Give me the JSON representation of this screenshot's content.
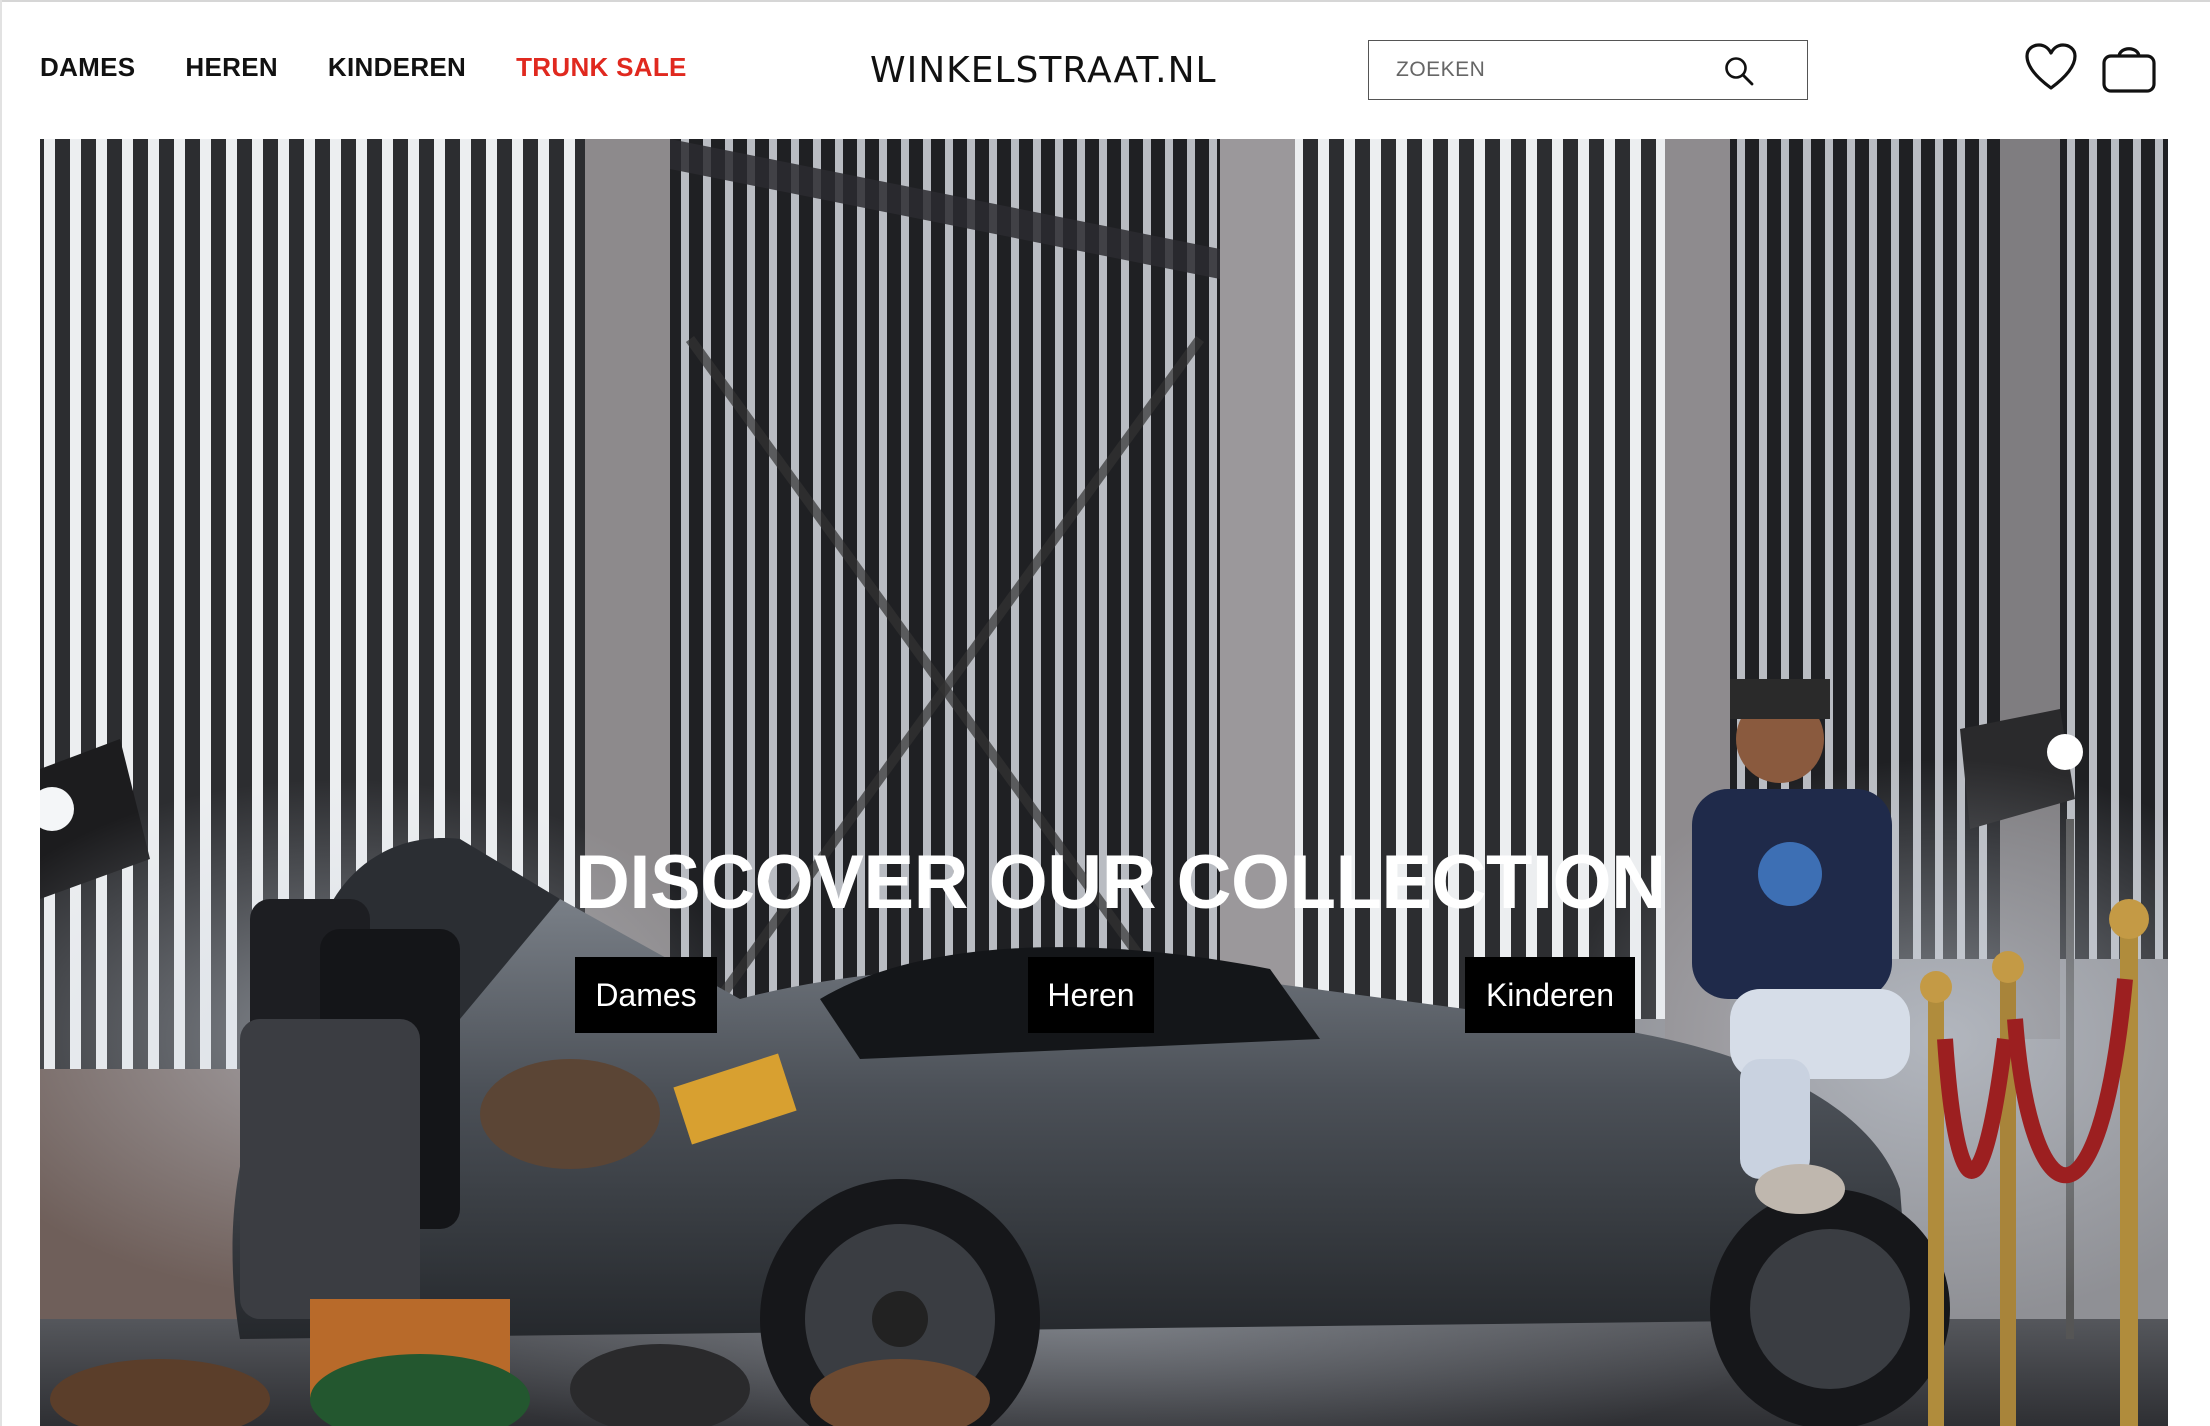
{
  "nav": {
    "items": [
      "DAMES",
      "HEREN",
      "KINDEREN",
      "TRUNK SALE"
    ],
    "sale_color": "#e0291f"
  },
  "brand": {
    "logo": "WINKELSTRAAT.NL"
  },
  "search": {
    "placeholder": "ZOEKEN",
    "value": ""
  },
  "icons": {
    "search": "search-icon",
    "wishlist": "heart-icon",
    "cart": "shopping-bag-icon"
  },
  "hero": {
    "title": "DISCOVER OUR COLLECTION",
    "buttons": [
      "Dames",
      "Heren",
      "Kinderen"
    ]
  }
}
